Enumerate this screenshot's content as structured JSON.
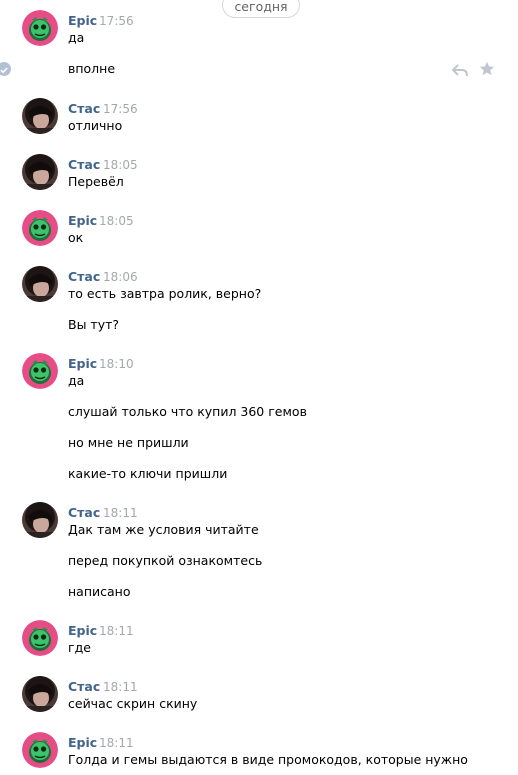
{
  "date_divider": "сегодня",
  "users": {
    "epic": {
      "name": "Epic"
    },
    "stas": {
      "name": "Стас"
    }
  },
  "groups": [
    {
      "sender": "Epic",
      "time": "17:56",
      "messages": [
        "да",
        "вполне"
      ]
    },
    {
      "sender": "Стас",
      "time": "17:56",
      "messages": [
        "отлично"
      ]
    },
    {
      "sender": "Стас",
      "time": "18:05",
      "messages": [
        "Перевёл"
      ]
    },
    {
      "sender": "Epic",
      "time": "18:05",
      "messages": [
        "ок"
      ]
    },
    {
      "sender": "Стас",
      "time": "18:06",
      "messages": [
        "то есть завтра ролик, верно?",
        "Вы тут?"
      ]
    },
    {
      "sender": "Epic",
      "time": "18:10",
      "messages": [
        "да",
        "слушай только что купил 360 гемов",
        "но мне не пришли",
        "какие-то ключи пришли"
      ]
    },
    {
      "sender": "Стас",
      "time": "18:11",
      "messages": [
        "Дак там же условия читайте",
        "перед покупкой ознакомтесь",
        "написано"
      ]
    },
    {
      "sender": "Epic",
      "time": "18:11",
      "messages": [
        "где"
      ]
    },
    {
      "sender": "Стас",
      "time": "18:11",
      "messages": [
        "сейчас скрин скину"
      ]
    },
    {
      "sender": "Epic",
      "time": "18:11",
      "messages": [
        "Голда и гемы выдаются в виде промокодов, которые нужно"
      ]
    }
  ],
  "icons": {
    "selected": "check-circle-icon",
    "reply": "reply-icon",
    "favorite": "star-icon"
  }
}
